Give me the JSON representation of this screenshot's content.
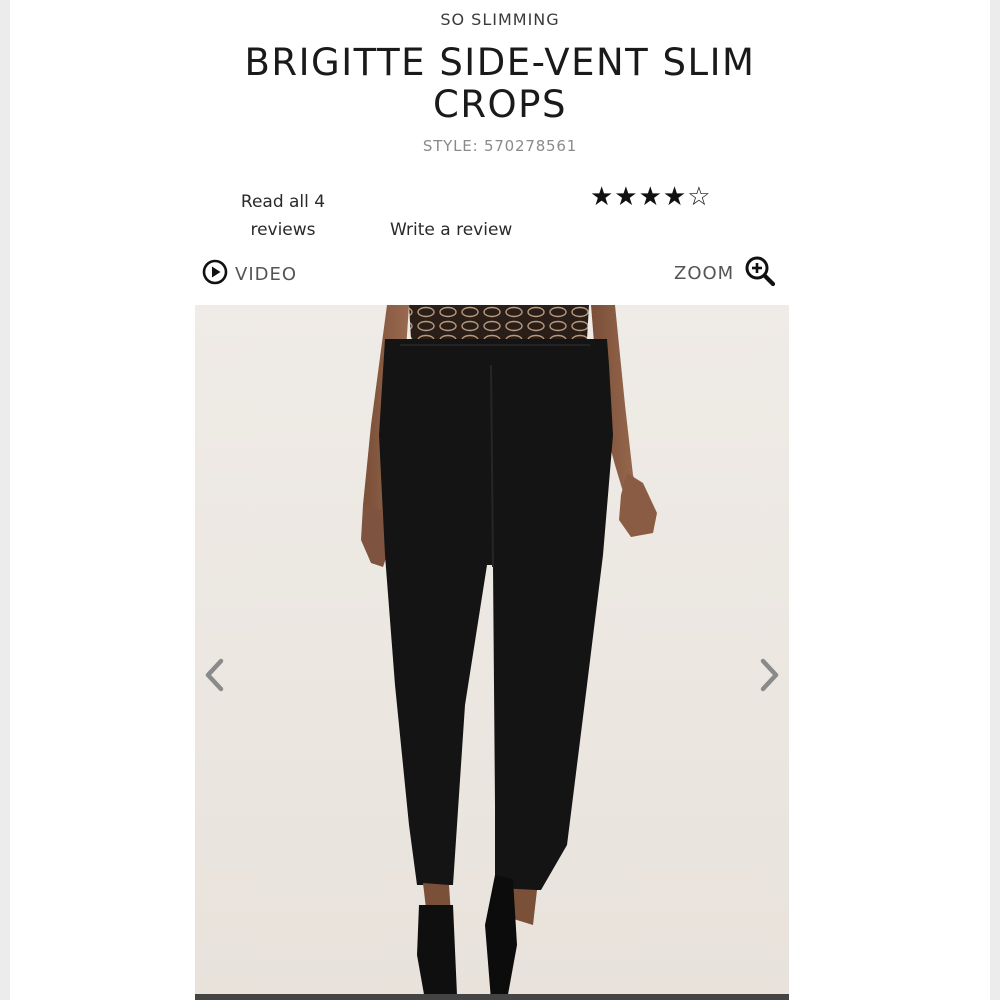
{
  "product": {
    "collection": "SO SLIMMING",
    "title": "BRIGITTE SIDE-VENT SLIM CROPS",
    "style_label": "STYLE: 570278561"
  },
  "reviews": {
    "read_all_label": "Read all 4 reviews",
    "write_label": "Write a review",
    "rating": 4,
    "max_rating": 5,
    "stars_text": "★★★★☆"
  },
  "media": {
    "video_label": "VIDEO",
    "zoom_label": "ZOOM"
  },
  "colors": {
    "text": "#1c1c1c",
    "muted": "#8a8a8a",
    "pants": "#141414",
    "background": "#efebe6"
  }
}
